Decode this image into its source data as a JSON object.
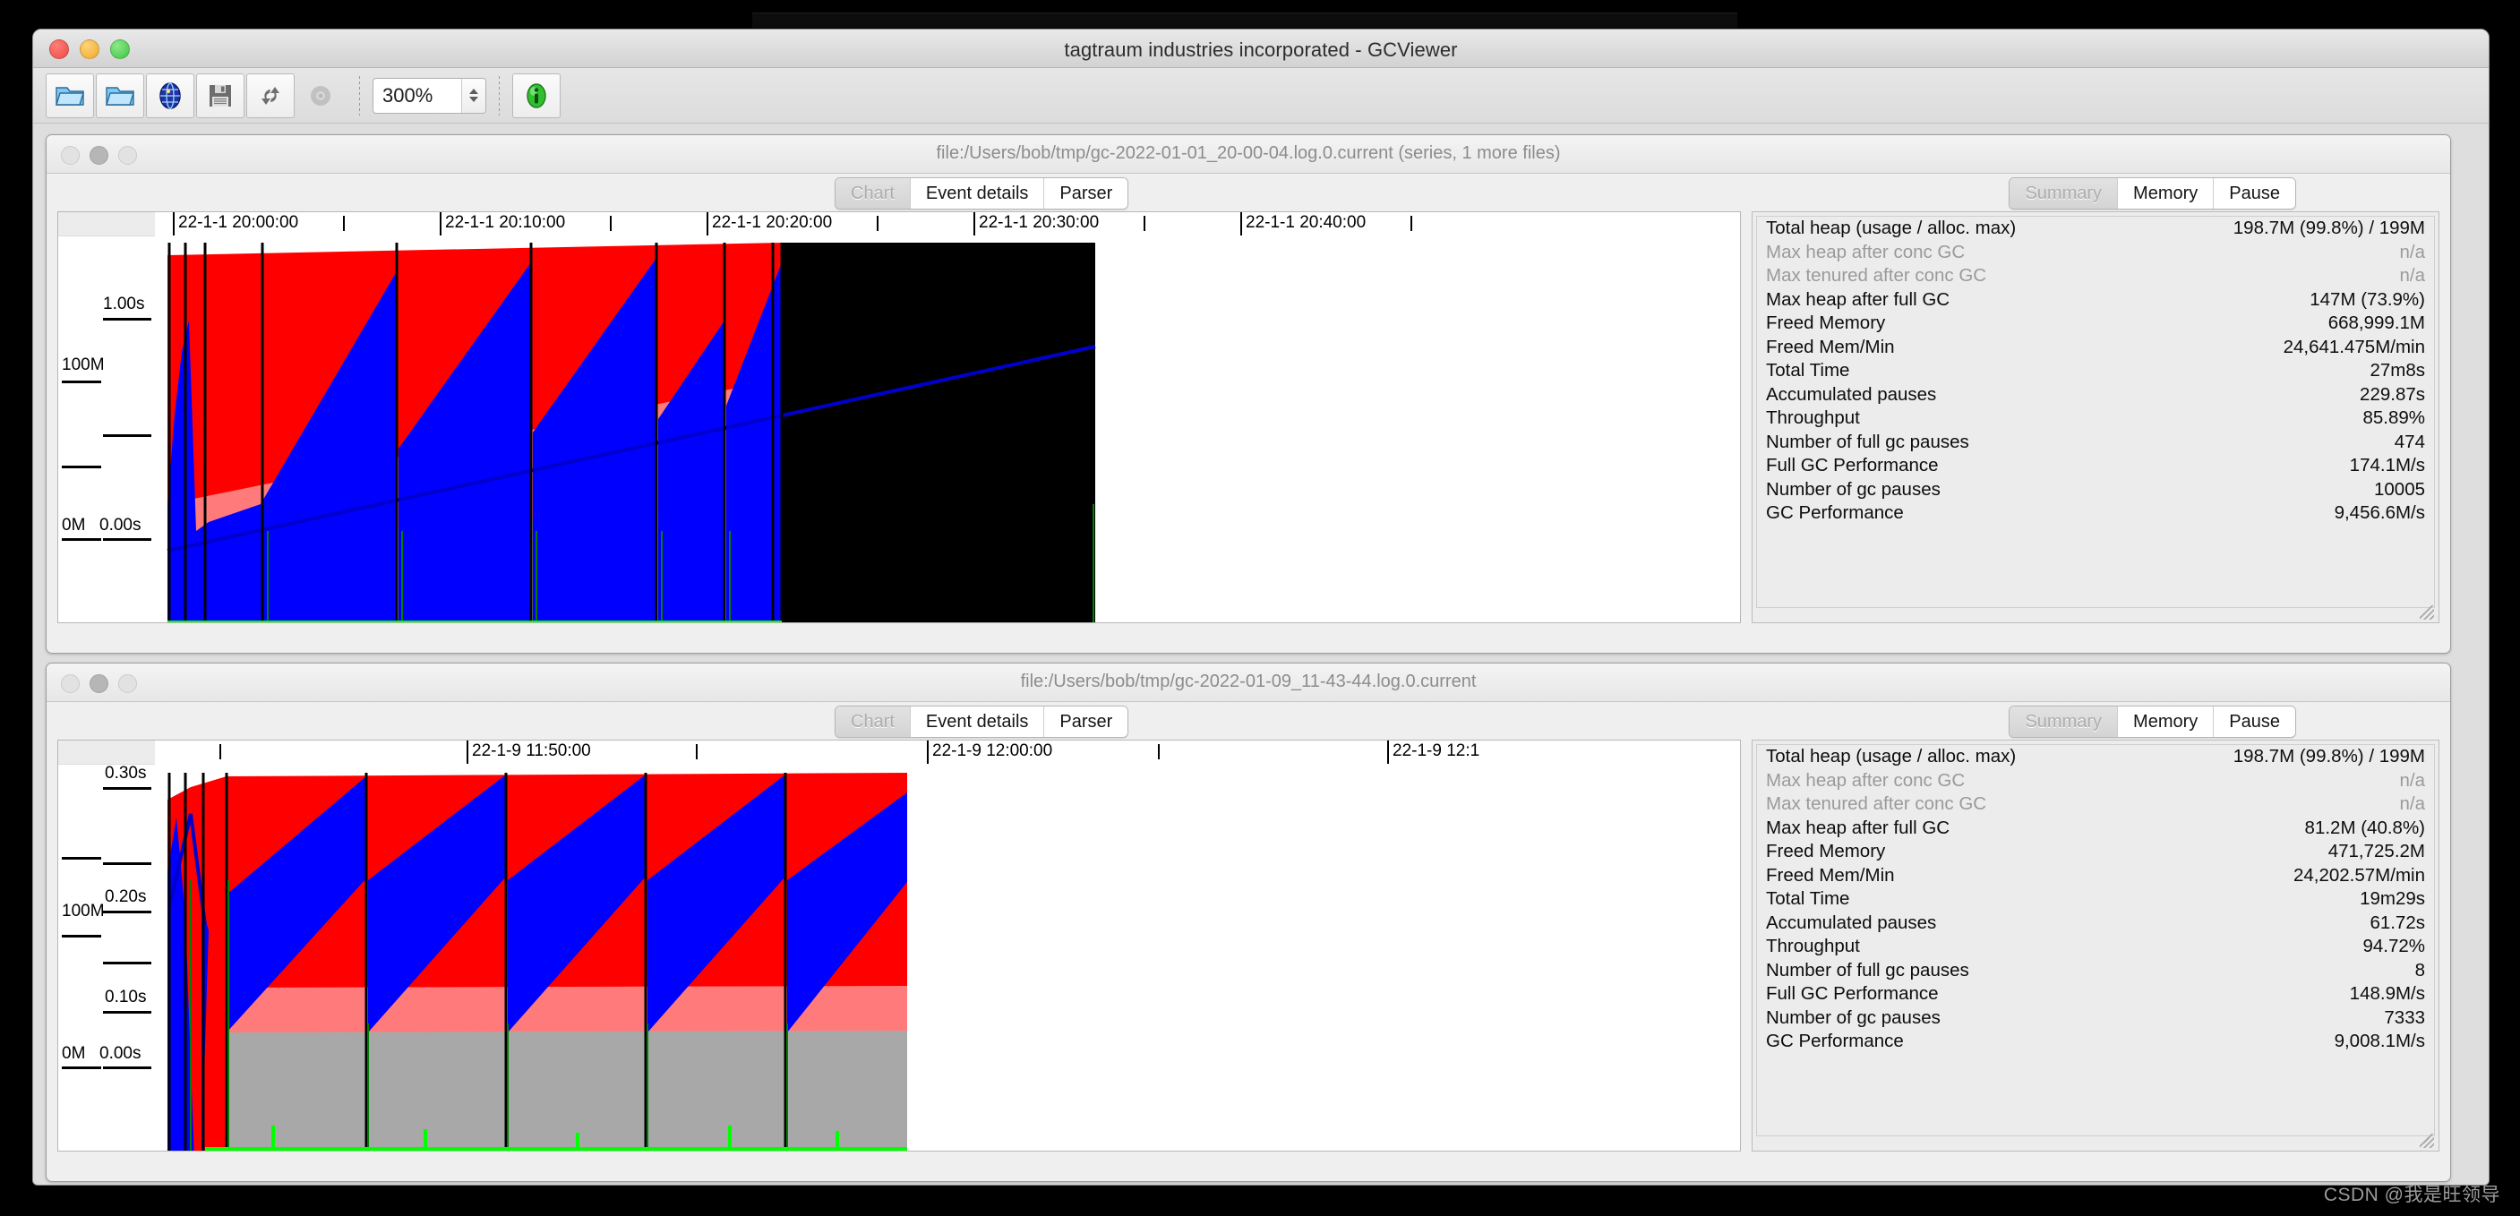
{
  "window": {
    "title": "tagtraum industries incorporated - GCViewer",
    "traffic_lights": [
      "close",
      "minimize",
      "maximize"
    ]
  },
  "toolbar": {
    "buttons": [
      {
        "name": "open-file-button",
        "icon": "folder-open-icon",
        "enabled": true
      },
      {
        "name": "open-series-button",
        "icon": "folder-open-icon",
        "enabled": true
      },
      {
        "name": "open-url-button",
        "icon": "globe-icon",
        "enabled": true
      },
      {
        "name": "export-button",
        "icon": "floppy-save-icon",
        "enabled": true
      },
      {
        "name": "refresh-button",
        "icon": "refresh-icon",
        "enabled": true
      },
      {
        "name": "settings-button",
        "icon": "gear-icon",
        "enabled": false
      }
    ],
    "zoom": {
      "value": "300%",
      "name": "zoom-combo"
    },
    "about": {
      "name": "about-button",
      "icon": "info-icon"
    }
  },
  "panels": [
    {
      "title": "file:/Users/bob/tmp/gc-2022-01-01_20-00-04.log.0.current (series, 1 more files)",
      "left_tabs": {
        "items": [
          "Chart",
          "Event details",
          "Parser"
        ],
        "selected": 0
      },
      "right_tabs": {
        "items": [
          "Summary",
          "Memory",
          "Pause"
        ],
        "selected": 0
      },
      "summary": [
        {
          "key": "Total heap (usage / alloc. max)",
          "value": "198.7M (99.8%) / 199M",
          "dim": false
        },
        {
          "key": "Max heap after conc GC",
          "value": "n/a",
          "dim": true
        },
        {
          "key": "Max tenured after conc GC",
          "value": "n/a",
          "dim": true
        },
        {
          "key": "Max heap after full GC",
          "value": "147M (73.9%)",
          "dim": false
        },
        {
          "key": "Freed Memory",
          "value": "668,999.1M",
          "dim": false
        },
        {
          "key": "Freed Mem/Min",
          "value": "24,641.475M/min",
          "dim": false
        },
        {
          "key": "Total Time",
          "value": "27m8s",
          "dim": false
        },
        {
          "key": "Accumulated pauses",
          "value": "229.87s",
          "dim": false
        },
        {
          "key": "Throughput",
          "value": "85.89%",
          "dim": false
        },
        {
          "key": "Number of full gc pauses",
          "value": "474",
          "dim": false
        },
        {
          "key": "Full GC Performance",
          "value": "174.1M/s",
          "dim": false
        },
        {
          "key": "Number of gc pauses",
          "value": "10005",
          "dim": false
        },
        {
          "key": "GC Performance",
          "value": "9,456.6M/s",
          "dim": false
        }
      ],
      "chart_data": {
        "type": "area",
        "title": "GC heap usage over time",
        "xlabel": "",
        "ylabel": "",
        "grid": false,
        "legend": "none",
        "x_axis": {
          "tick_labels": [
            "22-1-1 20:00:00",
            "22-1-1 20:10:00",
            "22-1-1 20:20:00",
            "22-1-1 20:30:00",
            "22-1-1 20:40:00"
          ],
          "tick_positions_pct": [
            1.5,
            18.5,
            35.5,
            52.5,
            69.5
          ],
          "minor_tick_positions_pct": [
            9.7,
            26.7,
            43.6,
            60.6,
            77.5
          ]
        },
        "y_axis_memory": {
          "tick_labels": [
            "0M",
            "100M"
          ],
          "tick_values": [
            0,
            100
          ],
          "unit": "M"
        },
        "y_axis_pause": {
          "tick_labels": [
            "0.00s",
            "1.00s"
          ],
          "tick_values": [
            0.0,
            1.0
          ],
          "unit": "s"
        },
        "series": [
          {
            "name": "total heap",
            "color": "#ff0000",
            "role": "heap-allocated-area"
          },
          {
            "name": "used heap",
            "color": "#0000ff",
            "role": "heap-used-area"
          },
          {
            "name": "tenured",
            "color": "#ff7b7b",
            "role": "tenured-area"
          },
          {
            "name": "used tenured",
            "color": "#a8a8a8",
            "role": "used-tenured-area"
          },
          {
            "name": "full gc lines",
            "color": "#000000",
            "role": "full-gc-marker"
          },
          {
            "name": "inc gc lines",
            "color": "#008000",
            "role": "inc-gc-marker"
          },
          {
            "name": "gc times",
            "color": "#00ff00",
            "role": "gc-pause-bars"
          },
          {
            "name": "total heap trend",
            "color": "#0000cc",
            "role": "trend-line"
          },
          {
            "name": "no-data region",
            "color": "#000000",
            "role": "black-block"
          }
        ],
        "data_extent_pct": 35.8,
        "sawtooth_cycles": 6
      }
    },
    {
      "title": "file:/Users/bob/tmp/gc-2022-01-09_11-43-44.log.0.current",
      "left_tabs": {
        "items": [
          "Chart",
          "Event details",
          "Parser"
        ],
        "selected": 0
      },
      "right_tabs": {
        "items": [
          "Summary",
          "Memory",
          "Pause"
        ],
        "selected": 0
      },
      "summary": [
        {
          "key": "Total heap (usage / alloc. max)",
          "value": "198.7M (99.8%) / 199M",
          "dim": false
        },
        {
          "key": "Max heap after conc GC",
          "value": "n/a",
          "dim": true
        },
        {
          "key": "Max tenured after conc GC",
          "value": "n/a",
          "dim": true
        },
        {
          "key": "Max heap after full GC",
          "value": "81.2M (40.8%)",
          "dim": false
        },
        {
          "key": "Freed Memory",
          "value": "471,725.2M",
          "dim": false
        },
        {
          "key": "Freed Mem/Min",
          "value": "24,202.57M/min",
          "dim": false
        },
        {
          "key": "Total Time",
          "value": "19m29s",
          "dim": false
        },
        {
          "key": "Accumulated pauses",
          "value": "61.72s",
          "dim": false
        },
        {
          "key": "Throughput",
          "value": "94.72%",
          "dim": false
        },
        {
          "key": "Number of full gc pauses",
          "value": "8",
          "dim": false
        },
        {
          "key": "Full GC Performance",
          "value": "148.9M/s",
          "dim": false
        },
        {
          "key": "Number of gc pauses",
          "value": "7333",
          "dim": false
        },
        {
          "key": "GC Performance",
          "value": "9,008.1M/s",
          "dim": false
        }
      ],
      "chart_data": {
        "type": "area",
        "title": "GC heap usage over time",
        "xlabel": "",
        "ylabel": "",
        "grid": false,
        "legend": "none",
        "x_axis": {
          "tick_labels": [
            "22-1-9 11:50:00",
            "22-1-9 12:00:00",
            "22-1-9 12:1"
          ],
          "tick_positions_pct": [
            19.5,
            46.5,
            73.5
          ],
          "minor_tick_positions_pct": [
            5.0,
            32.0,
            59.0
          ]
        },
        "y_axis_memory": {
          "tick_labels": [
            "0M",
            "100M"
          ],
          "tick_values": [
            0,
            100
          ],
          "unit": "M"
        },
        "y_axis_pause": {
          "tick_labels": [
            "0.00s",
            "0.10s",
            "0.20s",
            "0.30s"
          ],
          "tick_values": [
            0.0,
            0.1,
            0.2,
            0.3
          ],
          "unit": "s"
        },
        "series": [
          {
            "name": "total heap",
            "color": "#ff0000",
            "role": "heap-allocated-area"
          },
          {
            "name": "used heap",
            "color": "#0000ff",
            "role": "heap-used-area"
          },
          {
            "name": "tenured",
            "color": "#ff7b7b",
            "role": "tenured-area"
          },
          {
            "name": "used tenured",
            "color": "#a8a8a8",
            "role": "used-tenured-area"
          },
          {
            "name": "full gc lines",
            "color": "#000000",
            "role": "full-gc-marker"
          },
          {
            "name": "inc gc lines",
            "color": "#008000",
            "role": "inc-gc-marker"
          },
          {
            "name": "gc times",
            "color": "#00ff00",
            "role": "gc-pause-bars"
          },
          {
            "name": "total heap trend",
            "color": "#0000cc",
            "role": "trend-line"
          }
        ],
        "data_extent_pct": 37.0,
        "sawtooth_cycles": 5
      }
    }
  ],
  "watermark": "CSDN @我是旺领导"
}
